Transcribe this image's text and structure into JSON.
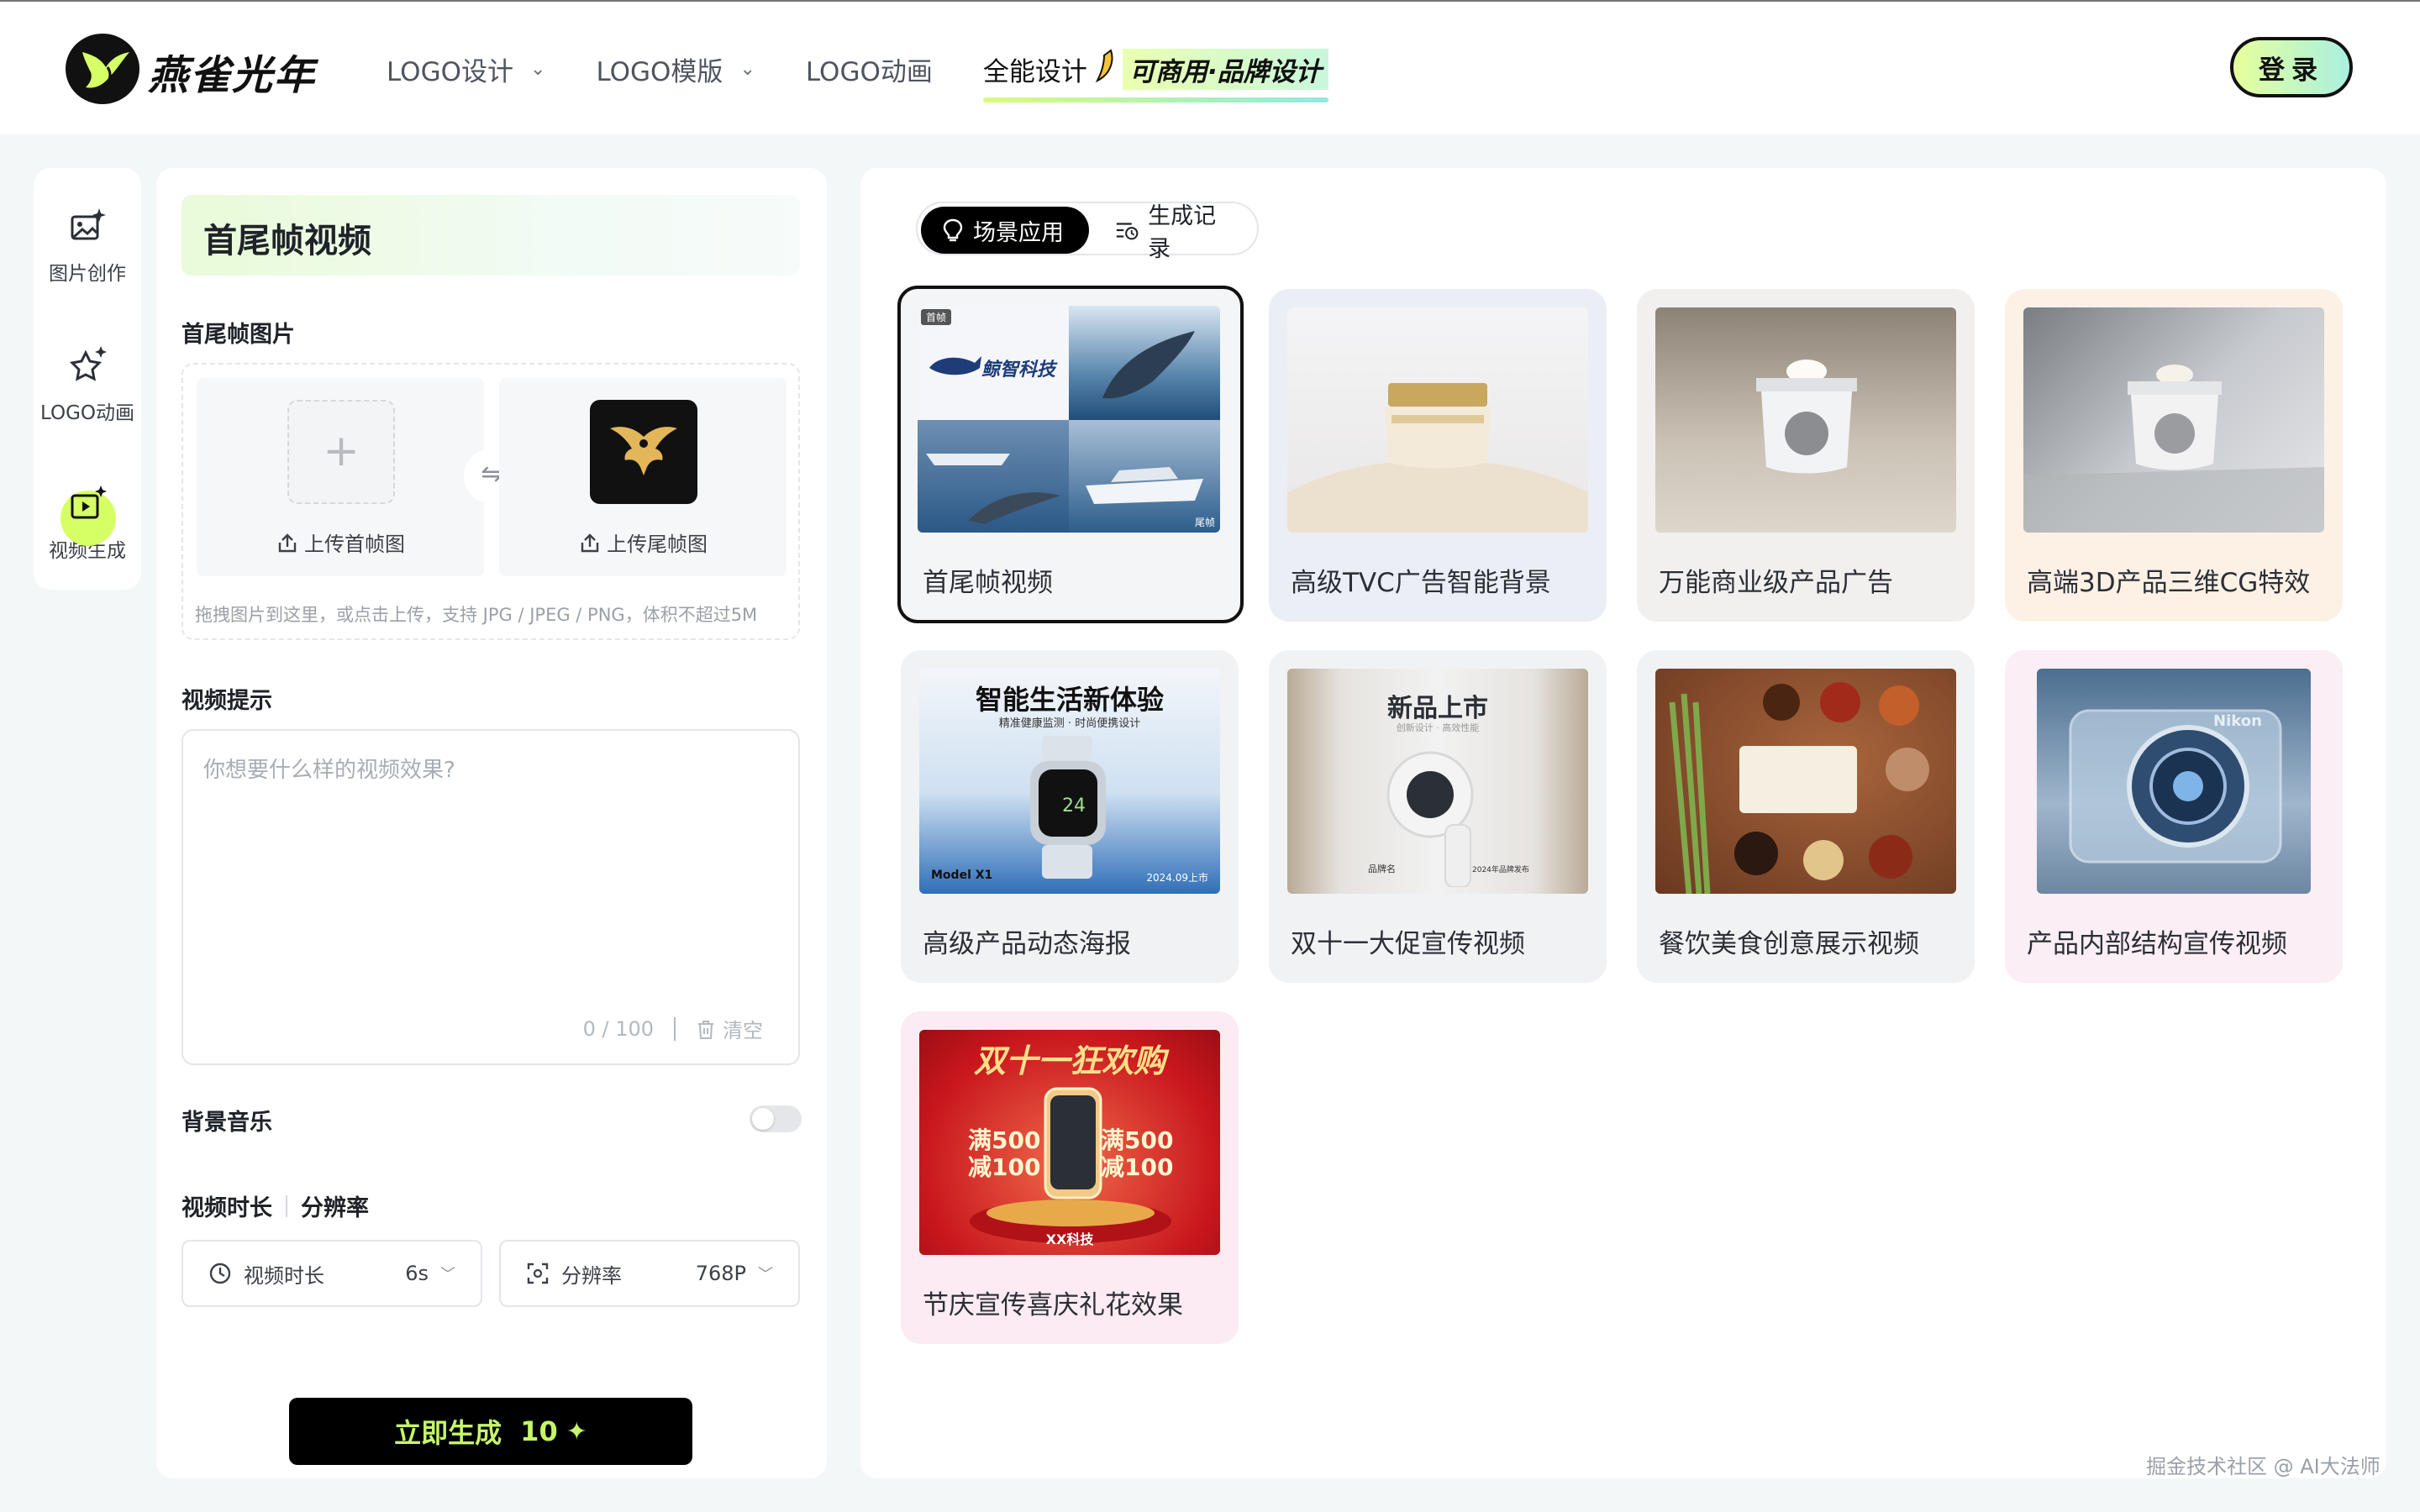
{
  "header": {
    "brand": "燕雀光年",
    "nav": [
      {
        "label": "LOGO设计",
        "has_dropdown": true
      },
      {
        "label": "LOGO模版",
        "has_dropdown": true
      },
      {
        "label": "LOGO动画",
        "has_dropdown": false
      }
    ],
    "special_nav": {
      "label": "全能设计",
      "tagline": "可商用·品牌设计",
      "icon": "banana-icon"
    },
    "login_label": "登录"
  },
  "sidebar": {
    "items": [
      {
        "label": "图片创作",
        "icon": "image-sparkle-icon",
        "active": false
      },
      {
        "label": "LOGO动画",
        "icon": "logo-star-icon",
        "active": false
      },
      {
        "label": "视频生成",
        "icon": "video-sparkle-icon",
        "active": true
      }
    ]
  },
  "panel": {
    "title": "首尾帧视频",
    "frames_label": "首尾帧图片",
    "upload_first_label": "上传首帧图",
    "upload_last_label": "上传尾帧图",
    "upload_hint": "拖拽图片到这里，或点击上传，支持 JPG / JPEG / PNG，体积不超过5M",
    "prompt_label": "视频提示",
    "prompt_placeholder": "你想要什么样的视频效果?",
    "prompt_counter": "0 / 100",
    "clear_label": "清空",
    "bgm_label": "背景音乐",
    "bgm_enabled": false,
    "duration_label": "视频时长",
    "resolution_label": "分辨率",
    "duration_select": {
      "label": "视频时长",
      "value": "6s"
    },
    "resolution_select": {
      "label": "分辨率",
      "value": "768P"
    },
    "generate_label": "立即生成",
    "generate_cost": "10"
  },
  "gallery": {
    "tabs": [
      {
        "label": "场景应用",
        "active": true
      },
      {
        "label": "生成记录",
        "active": false
      }
    ],
    "cards": [
      {
        "caption": "首尾帧视频",
        "selected": true,
        "bg": "#f4f5f6",
        "img_top_text": "鲸智科技",
        "tag_first": "首帧",
        "tag_last": "尾帧"
      },
      {
        "caption": "高级TVC广告智能背景",
        "bg": "#eceef5"
      },
      {
        "caption": "万能商业级产品广告",
        "bg": "#f1f0ef"
      },
      {
        "caption": "高端3D产品三维CG特效",
        "bg": "#fdf1e6"
      },
      {
        "caption": "高级产品动态海报",
        "bg": "#f1f2f4",
        "img_title": "智能生活新体验",
        "img_sub": "精准健康监测 · 时尚便携设计",
        "img_model": "Model X1",
        "img_date": "2024.09上市"
      },
      {
        "caption": "双十一大促宣传视频",
        "bg": "#f1f1f1",
        "img_title": "新品上市",
        "img_sub": "创新设计 · 高效性能",
        "img_brand": "品牌名",
        "img_date": "2024年品牌发布"
      },
      {
        "caption": "餐饮美食创意展示视频",
        "bg": "#f1f1f1"
      },
      {
        "caption": "产品内部结构宣传视频",
        "bg": "#fbeef4",
        "img_brand": "Nikon"
      },
      {
        "caption": "节庆宣传喜庆礼花效果",
        "bg": "#fcebf2",
        "img_title": "双十一狂欢购",
        "img_left": "满500减100",
        "img_right": "满500减100",
        "img_brand": "XX科技"
      }
    ]
  },
  "watermark": "掘金技术社区 @ AI大法师",
  "colors": {
    "accent_lime": "#d6ff66",
    "accent_mint": "#a9f0e1",
    "text_dark": "#1f2329",
    "generate_text": "#c6f66a"
  }
}
